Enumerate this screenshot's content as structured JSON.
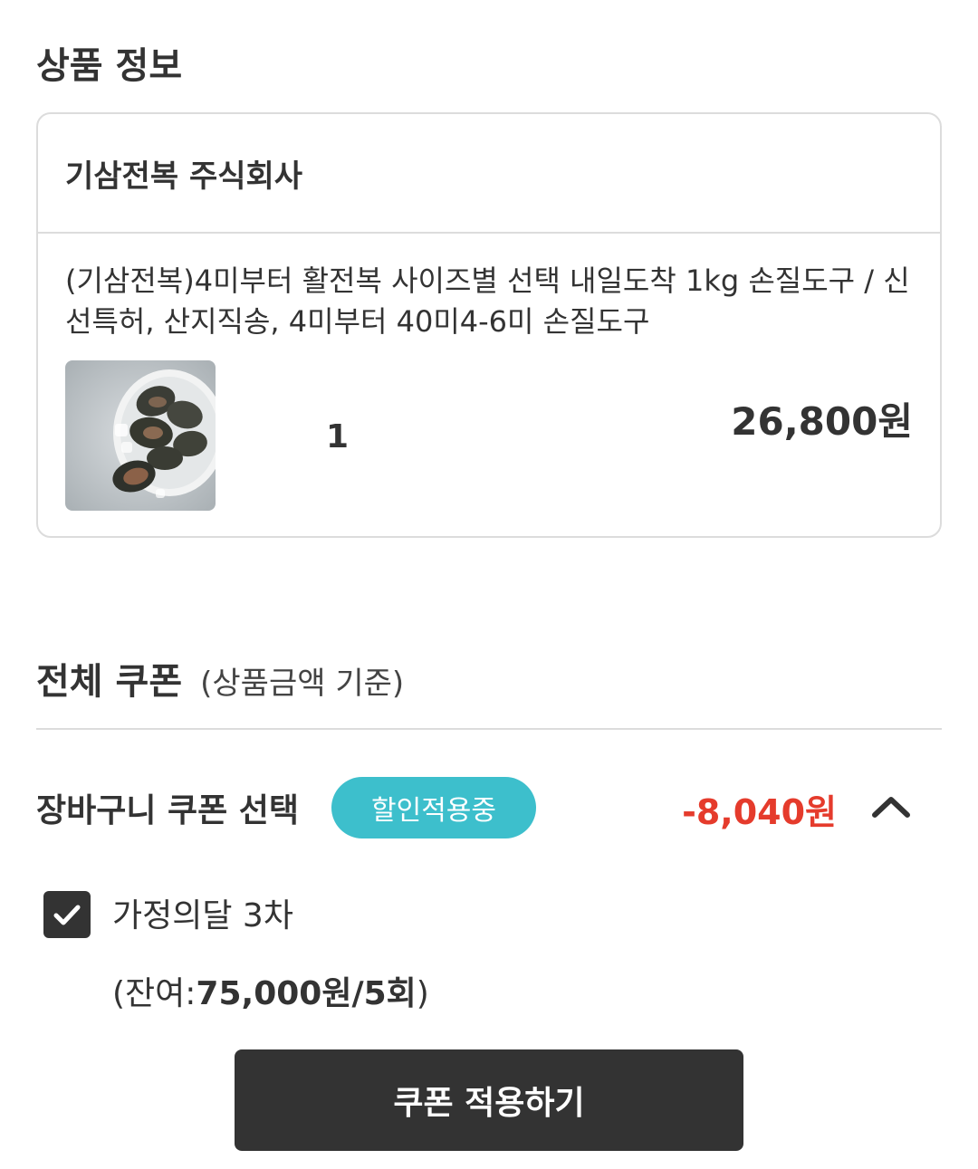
{
  "header": {
    "title": "상품 정보"
  },
  "product": {
    "seller": "기삼전복 주식회사",
    "name": "(기삼전복)4미부터 활전복 사이즈별 선택 내일도착 1kg 손질도구 / 신선특허, 산지직송, 4미부터 40미4-6미 손질도구",
    "quantity": "1",
    "price": "26,800원",
    "thumbnail_icon": "abalone-image"
  },
  "coupon_section": {
    "title": "전체 쿠폰",
    "subtitle": "(상품금액 기준)",
    "basket_label": "장바구니 쿠폰 선택",
    "badge": "할인적용중",
    "discount": "-8,040원",
    "toggle_icon": "chevron-up-icon",
    "coupon": {
      "checked": true,
      "name": "가정의달 3차",
      "remain_prefix": "(잔여:",
      "remain_value": "75,000원/5회",
      "remain_suffix": ")"
    },
    "apply_button": "쿠폰 적용하기"
  },
  "colors": {
    "badge": "#3dbfcc",
    "discount": "#e53b2c",
    "button": "#333333"
  }
}
